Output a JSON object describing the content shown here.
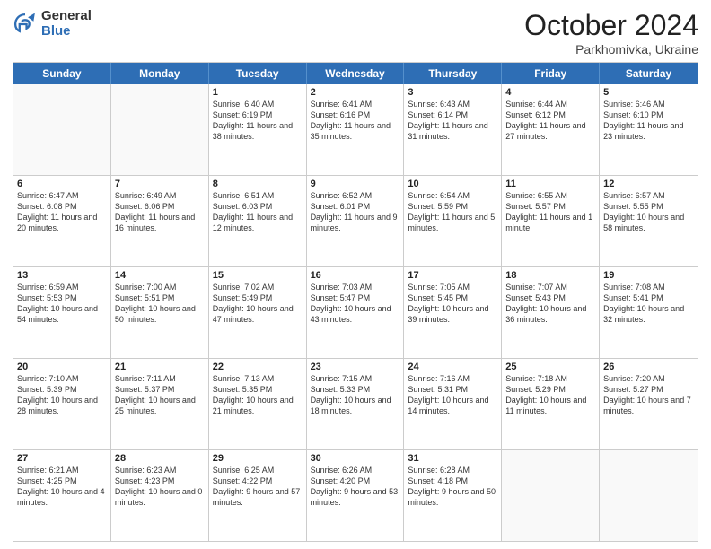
{
  "logo": {
    "general": "General",
    "blue": "Blue"
  },
  "header": {
    "month": "October 2024",
    "location": "Parkhomivka, Ukraine"
  },
  "days": [
    "Sunday",
    "Monday",
    "Tuesday",
    "Wednesday",
    "Thursday",
    "Friday",
    "Saturday"
  ],
  "rows": [
    [
      {
        "empty": true
      },
      {
        "empty": true
      },
      {
        "day": "1",
        "sunrise": "Sunrise: 6:40 AM",
        "sunset": "Sunset: 6:19 PM",
        "daylight": "Daylight: 11 hours and 38 minutes."
      },
      {
        "day": "2",
        "sunrise": "Sunrise: 6:41 AM",
        "sunset": "Sunset: 6:16 PM",
        "daylight": "Daylight: 11 hours and 35 minutes."
      },
      {
        "day": "3",
        "sunrise": "Sunrise: 6:43 AM",
        "sunset": "Sunset: 6:14 PM",
        "daylight": "Daylight: 11 hours and 31 minutes."
      },
      {
        "day": "4",
        "sunrise": "Sunrise: 6:44 AM",
        "sunset": "Sunset: 6:12 PM",
        "daylight": "Daylight: 11 hours and 27 minutes."
      },
      {
        "day": "5",
        "sunrise": "Sunrise: 6:46 AM",
        "sunset": "Sunset: 6:10 PM",
        "daylight": "Daylight: 11 hours and 23 minutes."
      }
    ],
    [
      {
        "day": "6",
        "sunrise": "Sunrise: 6:47 AM",
        "sunset": "Sunset: 6:08 PM",
        "daylight": "Daylight: 11 hours and 20 minutes."
      },
      {
        "day": "7",
        "sunrise": "Sunrise: 6:49 AM",
        "sunset": "Sunset: 6:06 PM",
        "daylight": "Daylight: 11 hours and 16 minutes."
      },
      {
        "day": "8",
        "sunrise": "Sunrise: 6:51 AM",
        "sunset": "Sunset: 6:03 PM",
        "daylight": "Daylight: 11 hours and 12 minutes."
      },
      {
        "day": "9",
        "sunrise": "Sunrise: 6:52 AM",
        "sunset": "Sunset: 6:01 PM",
        "daylight": "Daylight: 11 hours and 9 minutes."
      },
      {
        "day": "10",
        "sunrise": "Sunrise: 6:54 AM",
        "sunset": "Sunset: 5:59 PM",
        "daylight": "Daylight: 11 hours and 5 minutes."
      },
      {
        "day": "11",
        "sunrise": "Sunrise: 6:55 AM",
        "sunset": "Sunset: 5:57 PM",
        "daylight": "Daylight: 11 hours and 1 minute."
      },
      {
        "day": "12",
        "sunrise": "Sunrise: 6:57 AM",
        "sunset": "Sunset: 5:55 PM",
        "daylight": "Daylight: 10 hours and 58 minutes."
      }
    ],
    [
      {
        "day": "13",
        "sunrise": "Sunrise: 6:59 AM",
        "sunset": "Sunset: 5:53 PM",
        "daylight": "Daylight: 10 hours and 54 minutes."
      },
      {
        "day": "14",
        "sunrise": "Sunrise: 7:00 AM",
        "sunset": "Sunset: 5:51 PM",
        "daylight": "Daylight: 10 hours and 50 minutes."
      },
      {
        "day": "15",
        "sunrise": "Sunrise: 7:02 AM",
        "sunset": "Sunset: 5:49 PM",
        "daylight": "Daylight: 10 hours and 47 minutes."
      },
      {
        "day": "16",
        "sunrise": "Sunrise: 7:03 AM",
        "sunset": "Sunset: 5:47 PM",
        "daylight": "Daylight: 10 hours and 43 minutes."
      },
      {
        "day": "17",
        "sunrise": "Sunrise: 7:05 AM",
        "sunset": "Sunset: 5:45 PM",
        "daylight": "Daylight: 10 hours and 39 minutes."
      },
      {
        "day": "18",
        "sunrise": "Sunrise: 7:07 AM",
        "sunset": "Sunset: 5:43 PM",
        "daylight": "Daylight: 10 hours and 36 minutes."
      },
      {
        "day": "19",
        "sunrise": "Sunrise: 7:08 AM",
        "sunset": "Sunset: 5:41 PM",
        "daylight": "Daylight: 10 hours and 32 minutes."
      }
    ],
    [
      {
        "day": "20",
        "sunrise": "Sunrise: 7:10 AM",
        "sunset": "Sunset: 5:39 PM",
        "daylight": "Daylight: 10 hours and 28 minutes."
      },
      {
        "day": "21",
        "sunrise": "Sunrise: 7:11 AM",
        "sunset": "Sunset: 5:37 PM",
        "daylight": "Daylight: 10 hours and 25 minutes."
      },
      {
        "day": "22",
        "sunrise": "Sunrise: 7:13 AM",
        "sunset": "Sunset: 5:35 PM",
        "daylight": "Daylight: 10 hours and 21 minutes."
      },
      {
        "day": "23",
        "sunrise": "Sunrise: 7:15 AM",
        "sunset": "Sunset: 5:33 PM",
        "daylight": "Daylight: 10 hours and 18 minutes."
      },
      {
        "day": "24",
        "sunrise": "Sunrise: 7:16 AM",
        "sunset": "Sunset: 5:31 PM",
        "daylight": "Daylight: 10 hours and 14 minutes."
      },
      {
        "day": "25",
        "sunrise": "Sunrise: 7:18 AM",
        "sunset": "Sunset: 5:29 PM",
        "daylight": "Daylight: 10 hours and 11 minutes."
      },
      {
        "day": "26",
        "sunrise": "Sunrise: 7:20 AM",
        "sunset": "Sunset: 5:27 PM",
        "daylight": "Daylight: 10 hours and 7 minutes."
      }
    ],
    [
      {
        "day": "27",
        "sunrise": "Sunrise: 6:21 AM",
        "sunset": "Sunset: 4:25 PM",
        "daylight": "Daylight: 10 hours and 4 minutes."
      },
      {
        "day": "28",
        "sunrise": "Sunrise: 6:23 AM",
        "sunset": "Sunset: 4:23 PM",
        "daylight": "Daylight: 10 hours and 0 minutes."
      },
      {
        "day": "29",
        "sunrise": "Sunrise: 6:25 AM",
        "sunset": "Sunset: 4:22 PM",
        "daylight": "Daylight: 9 hours and 57 minutes."
      },
      {
        "day": "30",
        "sunrise": "Sunrise: 6:26 AM",
        "sunset": "Sunset: 4:20 PM",
        "daylight": "Daylight: 9 hours and 53 minutes."
      },
      {
        "day": "31",
        "sunrise": "Sunrise: 6:28 AM",
        "sunset": "Sunset: 4:18 PM",
        "daylight": "Daylight: 9 hours and 50 minutes."
      },
      {
        "empty": true
      },
      {
        "empty": true
      }
    ]
  ]
}
